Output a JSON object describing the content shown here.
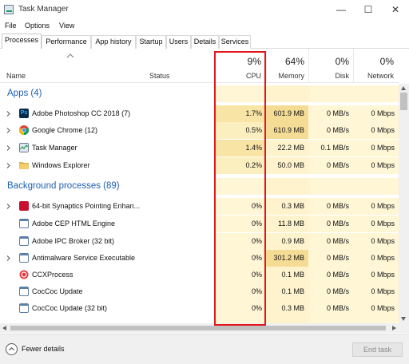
{
  "window": {
    "title": "Task Manager"
  },
  "menu": [
    "File",
    "Options",
    "View"
  ],
  "tabs": [
    "Processes",
    "Performance",
    "App history",
    "Startup",
    "Users",
    "Details",
    "Services"
  ],
  "header": {
    "name": "Name",
    "status": "Status",
    "cpu_pct": "9%",
    "cpu_label": "CPU",
    "memory_pct": "64%",
    "memory_label": "Memory",
    "disk_pct": "0%",
    "disk_label": "Disk",
    "network_pct": "0%",
    "network_label": "Network"
  },
  "groups": {
    "apps": "Apps (4)",
    "background": "Background processes (89)"
  },
  "apps": [
    {
      "name": "Adobe Photoshop CC 2018 (7)",
      "cpu": "1.7%",
      "memory": "601.9 MB",
      "disk": "0 MB/s",
      "network": "0 Mbps",
      "icon": "photoshop-icon",
      "color": "#0b2a4a"
    },
    {
      "name": "Google Chrome (12)",
      "cpu": "0.5%",
      "memory": "610.9 MB",
      "disk": "0 MB/s",
      "network": "0 Mbps",
      "icon": "chrome-icon",
      "color": "#db4437"
    },
    {
      "name": "Task Manager",
      "cpu": "1.4%",
      "memory": "22.2 MB",
      "disk": "0.1 MB/s",
      "network": "0 Mbps",
      "icon": "task-manager-icon",
      "color": "#3a7bd5"
    },
    {
      "name": "Windows Explorer",
      "cpu": "0.2%",
      "memory": "50.0 MB",
      "disk": "0 MB/s",
      "network": "0 Mbps",
      "icon": "folder-icon",
      "color": "#e8b84a"
    }
  ],
  "background": [
    {
      "name": "64-bit Synaptics Pointing Enhan...",
      "cpu": "0%",
      "memory": "0.3 MB",
      "disk": "0 MB/s",
      "network": "0 Mbps",
      "icon": "synaptics-icon",
      "color": "#c8102e",
      "expand": true
    },
    {
      "name": "Adobe CEP HTML Engine",
      "cpu": "0%",
      "memory": "11.8 MB",
      "disk": "0 MB/s",
      "network": "0 Mbps",
      "icon": "window-icon",
      "color": "#5b7fa6",
      "expand": false
    },
    {
      "name": "Adobe IPC Broker (32 bit)",
      "cpu": "0%",
      "memory": "0.9 MB",
      "disk": "0 MB/s",
      "network": "0 Mbps",
      "icon": "window-icon",
      "color": "#5b7fa6",
      "expand": false
    },
    {
      "name": "Antimalware Service Executable",
      "cpu": "0%",
      "memory": "301.2 MB",
      "disk": "0 MB/s",
      "network": "0 Mbps",
      "icon": "window-icon",
      "color": "#5b7fa6",
      "expand": true
    },
    {
      "name": "CCXProcess",
      "cpu": "0%",
      "memory": "0.1 MB",
      "disk": "0 MB/s",
      "network": "0 Mbps",
      "icon": "ccx-icon",
      "color": "#e03a3e",
      "expand": false
    },
    {
      "name": "CocCoc Update",
      "cpu": "0%",
      "memory": "0.1 MB",
      "disk": "0 MB/s",
      "network": "0 Mbps",
      "icon": "window-icon",
      "color": "#5b7fa6",
      "expand": false
    },
    {
      "name": "CocCoc Update (32 bit)",
      "cpu": "0%",
      "memory": "0.3 MB",
      "disk": "0 MB/s",
      "network": "0 Mbps",
      "icon": "window-icon",
      "color": "#5b7fa6",
      "expand": false
    }
  ],
  "footer": {
    "fewer_details": "Fewer details",
    "end_task": "End task"
  },
  "colors": {
    "accent_blue": "#1e5fb4",
    "highlight_red": "#e2161d",
    "heat_yellow": "#fbefbf"
  }
}
